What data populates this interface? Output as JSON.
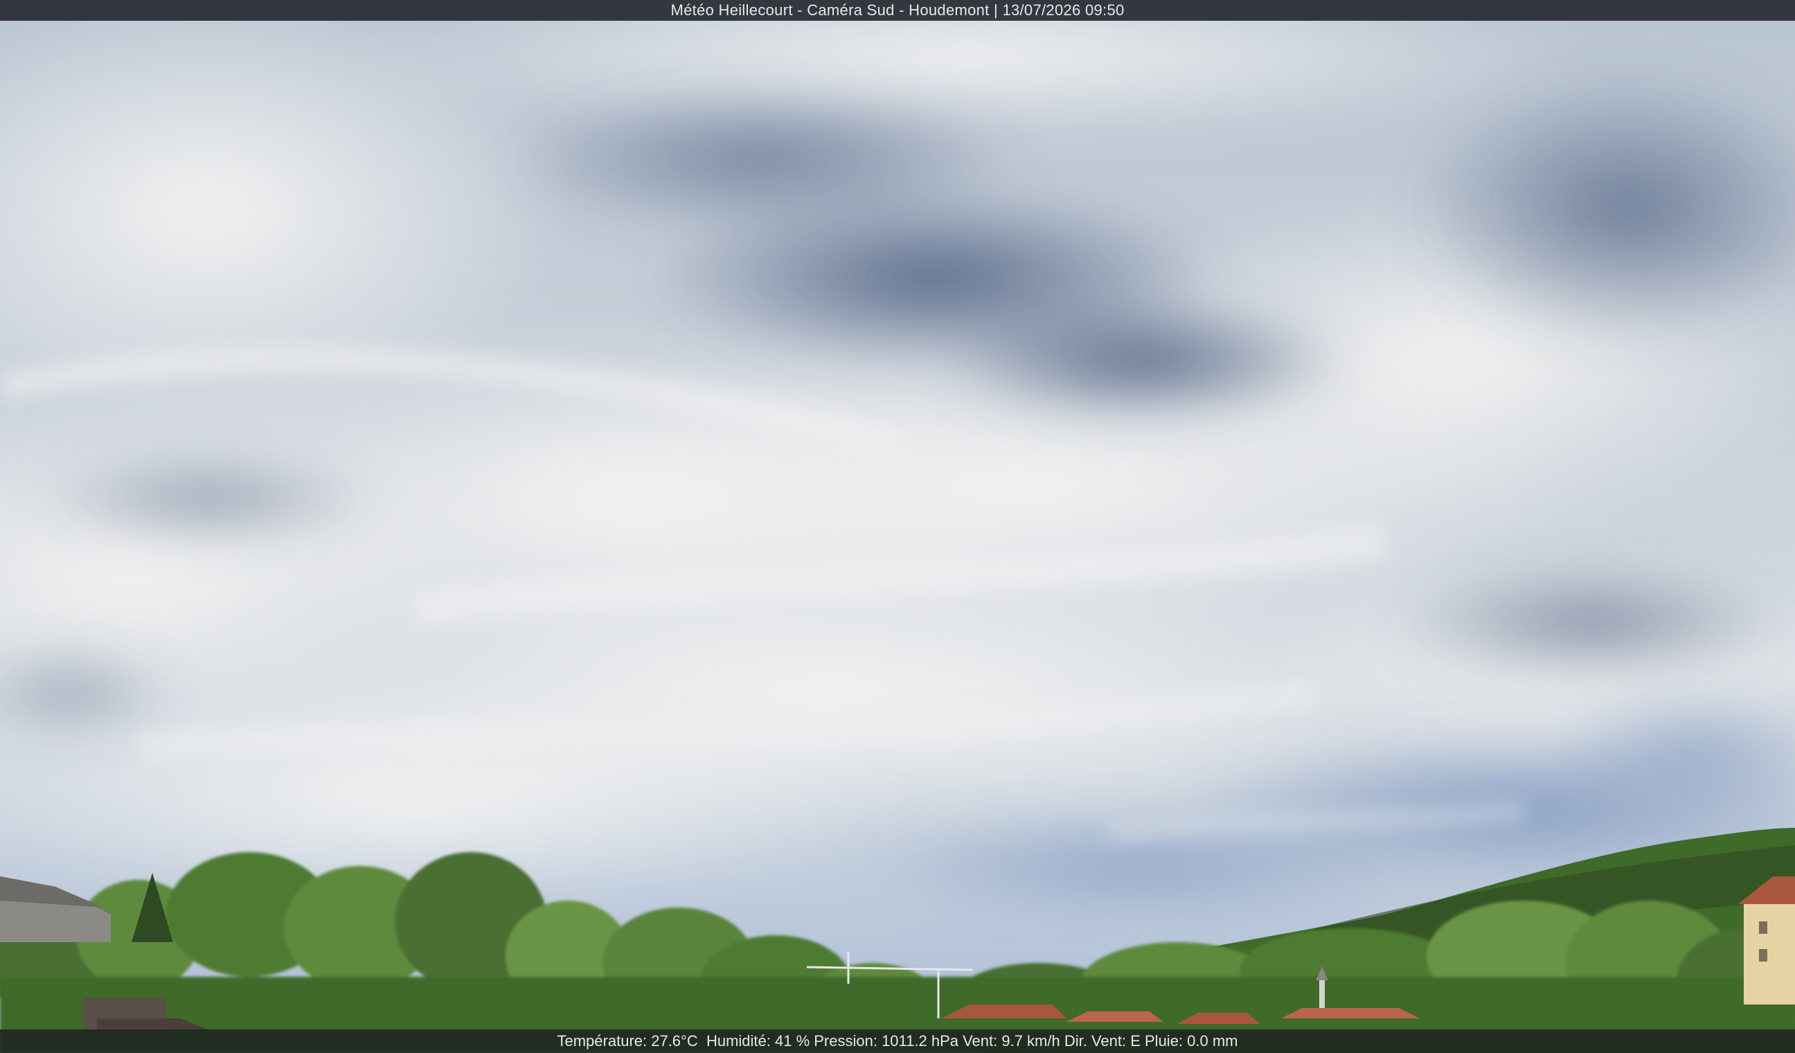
{
  "overlay": {
    "title": "Météo Heillecourt - Caméra Sud - Houdemont | 13/07/2026 09:50",
    "readings": "Température: 27.6°C  Humidité: 41 % Pression: 1011.2 hPa Vent: 9.7 km/h Dir. Vent: E Pluie: 0.0 mm"
  },
  "scene": {
    "sky_colors": [
      "#dfe3e8",
      "#aab6c8",
      "#5a6c8c",
      "#7f95bb"
    ],
    "foliage_colors": [
      "#3f6a2a",
      "#5f8a3c",
      "#2e4a22"
    ],
    "roof_color": "#a9563f"
  }
}
